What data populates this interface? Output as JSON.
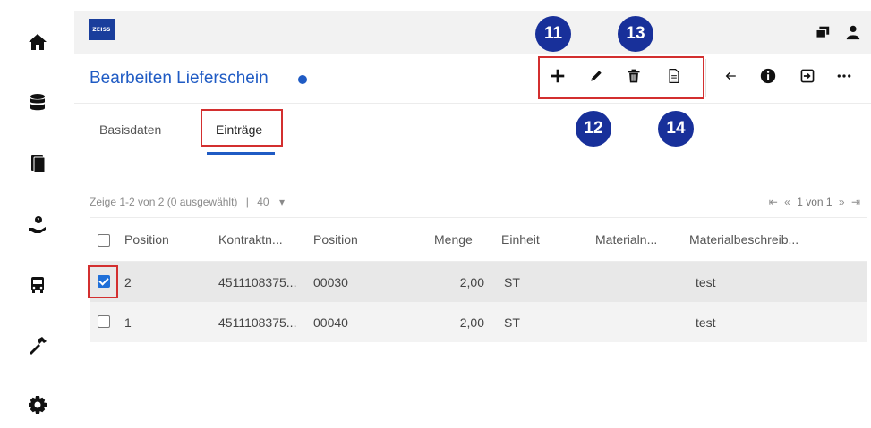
{
  "app": {
    "logo_text": "ZEISS",
    "brand_color": "#1a3e9c",
    "accent_color": "#1f5bc4",
    "highlight_color": "#d32f2f"
  },
  "sidebar": {
    "items": [
      {
        "name": "home",
        "icon": "home-icon"
      },
      {
        "name": "database",
        "icon": "database-icon"
      },
      {
        "name": "documents",
        "icon": "documents-icon"
      },
      {
        "name": "help-hand",
        "icon": "hand-help-icon"
      },
      {
        "name": "vehicle",
        "icon": "bus-icon"
      },
      {
        "name": "tools",
        "icon": "hammer-icon"
      },
      {
        "name": "settings",
        "icon": "gear-icon"
      }
    ]
  },
  "header": {
    "icons": [
      "windows-icon",
      "user-icon"
    ]
  },
  "page": {
    "title": "Bearbeiten Lieferschein"
  },
  "actions": {
    "highlighted": [
      "add-icon",
      "edit-icon",
      "delete-icon",
      "document-icon"
    ],
    "other": [
      "back-arrow-icon",
      "info-icon",
      "export-icon",
      "more-icon"
    ]
  },
  "callouts": [
    "11",
    "12",
    "13",
    "14"
  ],
  "tabs": [
    {
      "label": "Basisdaten",
      "active": false
    },
    {
      "label": "Einträge",
      "active": true
    }
  ],
  "paging": {
    "summary": "Zeige 1-2 von 2 (0 ausgewählt)",
    "separator": "|",
    "page_size": "40",
    "pager": "1 von 1"
  },
  "table": {
    "columns": [
      "Position",
      "Kontraktn...",
      "Position",
      "Menge",
      "Einheit",
      "Materialn...",
      "Materialbeschreib..."
    ],
    "rows": [
      {
        "checked": true,
        "position": "2",
        "kontrakt": "4511108375...",
        "pos2": "00030",
        "menge": "2,00",
        "einheit": "ST",
        "materialn": "",
        "beschreibung": "test"
      },
      {
        "checked": false,
        "position": "1",
        "kontrakt": "4511108375...",
        "pos2": "00040",
        "menge": "2,00",
        "einheit": "ST",
        "materialn": "",
        "beschreibung": "test"
      }
    ]
  }
}
